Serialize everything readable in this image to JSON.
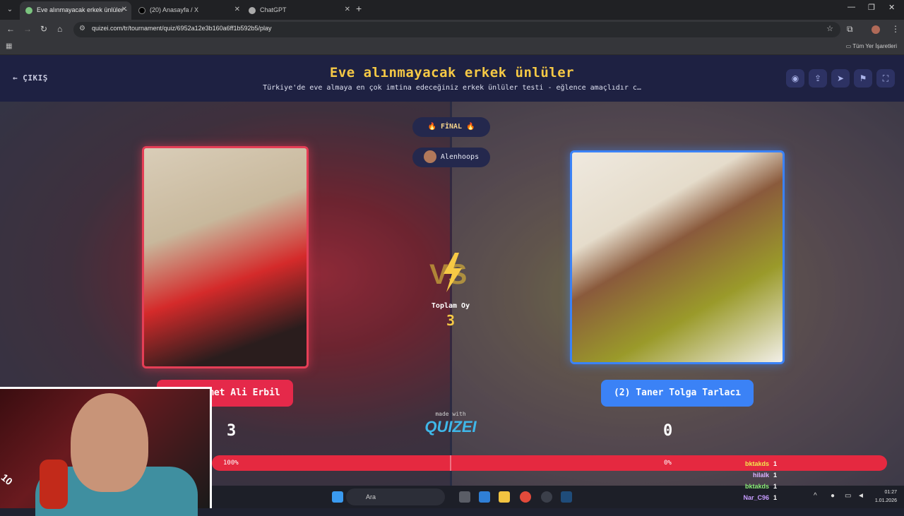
{
  "browser": {
    "tabs": [
      {
        "title": "Eve alınmayacak erkek ünlüler -",
        "active": true
      },
      {
        "title": "(20) Anasayfa / X",
        "active": false
      },
      {
        "title": "ChatGPT",
        "active": false
      }
    ],
    "url": "quizei.com/tr/tournament/quiz/6952a12e3b160a6ff1b592b5/play",
    "all_bookmarks": "Tüm Yer İşaretleri"
  },
  "header": {
    "exit_label": "ÇIKIŞ",
    "title": "Eve alınmayacak erkek ünlüler",
    "subtitle": "Türkiye'de eve almaya en çok imtina edeceğiniz erkek ünlüler testi - eğlence amaçlıdır c…"
  },
  "round": {
    "stage": "🔥 FİNAL 🔥",
    "user": "Alenhoops",
    "total_label": "Toplam Oy",
    "total_value": "3"
  },
  "left": {
    "name": "(1) Mehmet Ali Erbil",
    "votes": "3",
    "percent": "100%"
  },
  "right": {
    "name": "(2) Taner Tolga Tarlacı",
    "votes": "0",
    "percent": "0%"
  },
  "footer": {
    "made_with": "made with",
    "brand": "QUIZEI"
  },
  "chat": [
    {
      "user": "bktakds",
      "value": "1",
      "color": "#f2e94e"
    },
    {
      "user": "hilalk",
      "value": "1",
      "color": "#d9b3ff"
    },
    {
      "user": "bktakds",
      "value": "1",
      "color": "#8ef27a"
    },
    {
      "user": "Nar_C96",
      "value": "1",
      "color": "#c79cff"
    }
  ],
  "cam": {
    "tag": "10"
  },
  "taskbar": {
    "search_placeholder": "Ara",
    "time": "01:27",
    "date": "1.01.2026"
  }
}
